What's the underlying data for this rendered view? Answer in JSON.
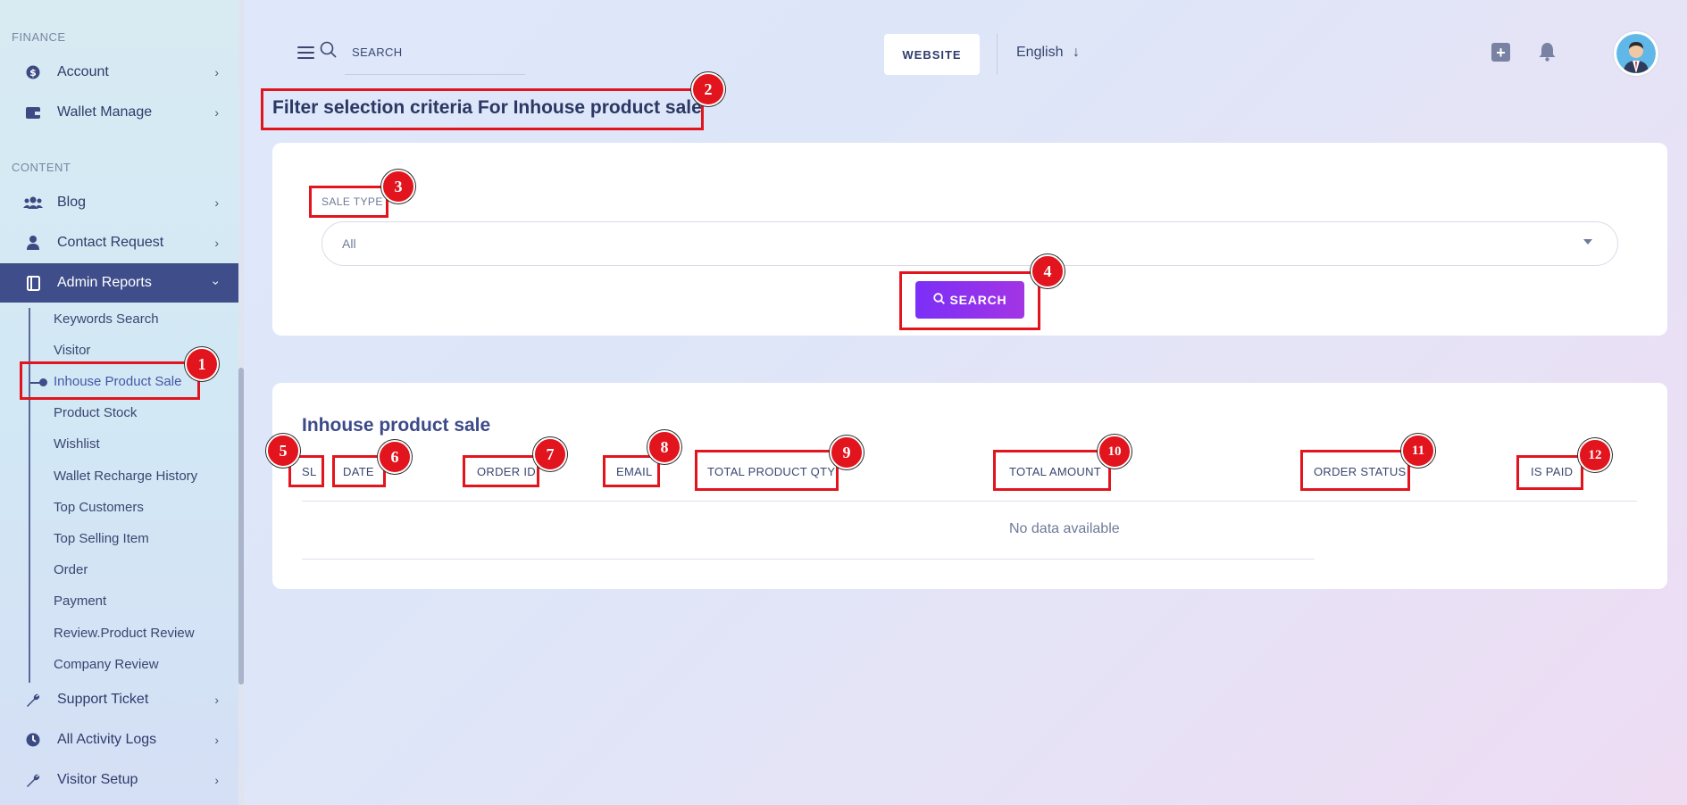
{
  "sidebar": {
    "sections": [
      {
        "title": "FINANCE"
      },
      {
        "title": "CONTENT"
      }
    ],
    "items": [
      {
        "label": "Account",
        "icon": "dollar-circle-icon"
      },
      {
        "label": "Wallet Manage",
        "icon": "wallet-icon"
      },
      {
        "label": "Blog",
        "icon": "users-icon"
      },
      {
        "label": "Contact Request",
        "icon": "user-icon"
      },
      {
        "label": "Admin Reports",
        "icon": "book-icon"
      },
      {
        "label": "Support Ticket",
        "icon": "wrench-icon"
      },
      {
        "label": "All Activity Logs",
        "icon": "clock-icon"
      },
      {
        "label": "Visitor Setup",
        "icon": "wrench-icon"
      }
    ],
    "sub_items": [
      "Keywords Search",
      "Visitor",
      "Inhouse Product Sale",
      "Product Stock",
      "Wishlist",
      "Wallet Recharge History",
      "Top Customers",
      "Top Selling Item",
      "Order",
      "Payment",
      "Review.Product Review",
      "Company Review"
    ]
  },
  "header": {
    "search_placeholder": "SEARCH",
    "website_label": "WEBSITE",
    "language": "English"
  },
  "page": {
    "title": "Filter selection criteria For Inhouse product sale"
  },
  "filter": {
    "sale_type_label": "SALE TYPE",
    "sale_type_value": "All",
    "search_button": "SEARCH"
  },
  "table": {
    "title": "Inhouse product sale",
    "columns": [
      "SL",
      "DATE",
      "ORDER ID",
      "EMAIL",
      "TOTAL PRODUCT QTY",
      "TOTAL AMOUNT",
      "ORDER STATUS",
      "IS PAID"
    ],
    "empty_message": "No data available"
  },
  "annotations": [
    "1",
    "2",
    "3",
    "4",
    "5",
    "6",
    "7",
    "8",
    "9",
    "10",
    "11",
    "12"
  ],
  "colors": {
    "accent_nav": "#3f4e8a",
    "search_button_start": "#7b2ff7",
    "search_button_end": "#a335e4",
    "annotation": "#e2141d"
  }
}
